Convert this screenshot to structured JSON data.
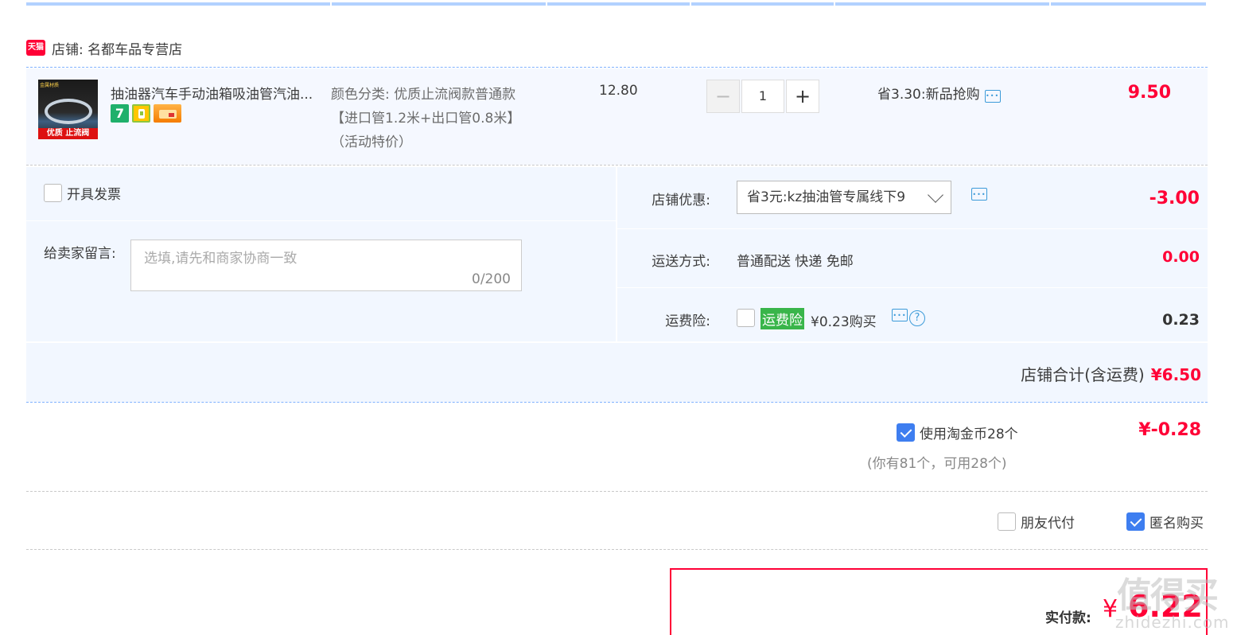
{
  "shop": {
    "badge_text": "天猫",
    "label": "店铺: 名都车品专营店"
  },
  "item": {
    "thumb_tag": "金属材质",
    "thumb_band": "优质 止流阀",
    "title": "抽油器汽车手动油箱吸油管汽油...",
    "badge1": "7",
    "sku_line1": "颜色分类: 优质止流阀款普通款",
    "sku_line2": "【进口管1.2米+出口管0.8米】",
    "sku_line3": "（活动特价）",
    "unit_price": "12.80",
    "quantity": "1",
    "minus": "−",
    "plus": "+",
    "promo": "省3.30:新品抢购",
    "total": "9.50"
  },
  "invoice": {
    "label": "开具发票"
  },
  "message": {
    "label": "给卖家留言:",
    "placeholder": "选填,请先和商家协商一致",
    "counter": "0/200"
  },
  "store_discount": {
    "label": "店铺优惠:",
    "selected": "省3元:kz抽油管专属线下9",
    "amount": "-3.00"
  },
  "shipping": {
    "label": "运送方式:",
    "value": "普通配送 快递 免邮",
    "amount": "0.00"
  },
  "insurance": {
    "label": "运费险:",
    "tag": "运费险",
    "price_text": "¥0.23购买",
    "help": "?",
    "amount": "0.23"
  },
  "shop_total": {
    "label": "店铺合计(含运费)",
    "amount": "¥6.50"
  },
  "coins": {
    "label": "使用淘金币28个",
    "amount": "¥-0.28",
    "sub": "(你有81个，可用28个)"
  },
  "options": {
    "friend_pay": "朋友代付",
    "anonymous": "匿名购买"
  },
  "payment": {
    "label": "实付款:",
    "currency": "¥",
    "amount": "6.22"
  },
  "watermark": {
    "big": "值得买",
    "small": "zhidezhi.com"
  },
  "colors": {
    "accent_red": "#ff0036",
    "accent_blue": "#3e7ef0",
    "panel_bg": "#f2f7ff",
    "insurance_green": "#39b54a"
  }
}
